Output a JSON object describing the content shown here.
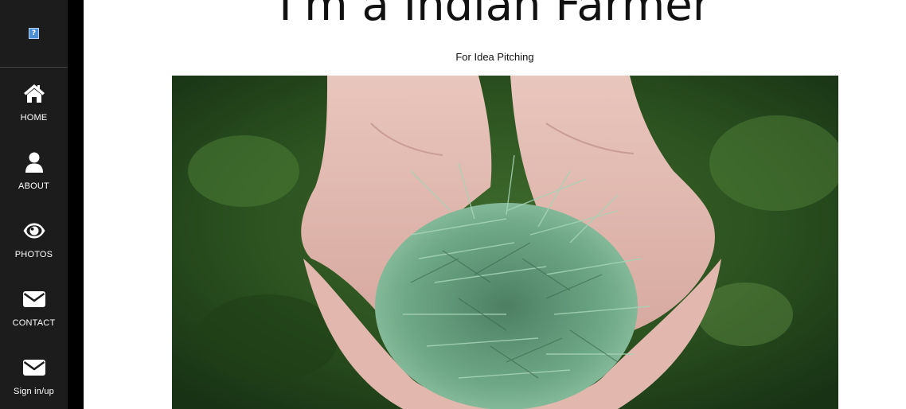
{
  "sidebar": {
    "brand_icon": "broken-image-icon",
    "brand_glyph": "?",
    "items": [
      {
        "label": "HOME",
        "icon": "home-icon"
      },
      {
        "label": "ABOUT",
        "icon": "user-icon"
      },
      {
        "label": "PHOTOS",
        "icon": "eye-icon"
      },
      {
        "label": "CONTACT",
        "icon": "envelope-icon"
      },
      {
        "label": "Sign in/up",
        "icon": "envelope-icon"
      }
    ]
  },
  "main": {
    "title": "I'm a Indian Farmer",
    "subtitle": "For Idea Pitching",
    "hero_image": "hands-holding-pine-needles-photo"
  },
  "colors": {
    "sidebar_bg": "#1c1c1c",
    "sidebar_strip": "#000000",
    "text": "#111111",
    "page_bg": "#ffffff"
  }
}
